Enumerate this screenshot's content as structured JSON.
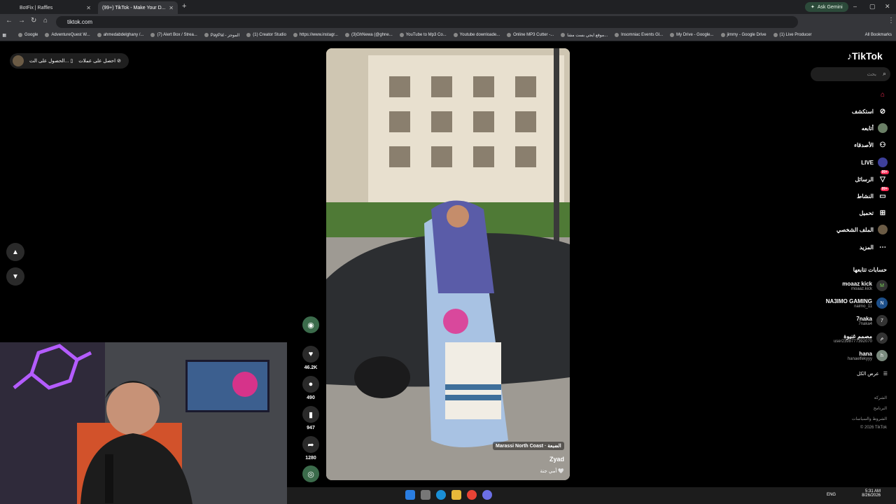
{
  "browser": {
    "tabs": [
      {
        "title": "BotFix | Raffles"
      },
      {
        "title": "(99+) TikTok - Make Your D..."
      }
    ],
    "new_tab": "+",
    "ask_gemini": "Ask Gemini",
    "url": "tiktok.com",
    "bookmarks": [
      "Google",
      "AdventureQuest W...",
      "ahmedabdelghany /...",
      "(7) Alert Box / Strea...",
      "PayPal - الموجز",
      "(1) Creator Studio",
      "https://www.instagr...",
      "(3)GhNewa (@ghne...",
      "YouTube to Mp3 Co...",
      "Youtube downloade...",
      "Online MP3 Cutter -...",
      "موقع ايجي بست مشا...",
      "Insomniac Events Gl...",
      "My Drive - Google...",
      "jimmy - Google Drive",
      "(1) Live Producer"
    ],
    "all_bookmarks": "All Bookmarks"
  },
  "tiktok": {
    "logo": "TikTok",
    "search_placeholder": "بحث",
    "get_coins": "احصل على عملات",
    "get_app": "الحصول على الت...",
    "nav": [
      {
        "label": "",
        "icon": "home-icon"
      },
      {
        "label": "استكشف",
        "icon": "compass-icon"
      },
      {
        "label": "أتابعه",
        "icon": "following-icon"
      },
      {
        "label": "الأصدقاء",
        "icon": "friends-icon"
      },
      {
        "label": "LIVE",
        "icon": "live-icon"
      },
      {
        "label": "الرسائل",
        "icon": "messages-icon",
        "badge": "99+"
      },
      {
        "label": "النشاط",
        "icon": "activity-icon",
        "badge": "99+"
      },
      {
        "label": "تحميل",
        "icon": "upload-icon"
      },
      {
        "label": "الملف الشخصي",
        "icon": "profile-icon"
      },
      {
        "label": "المزيد",
        "icon": "more-icon"
      }
    ],
    "following_title": "حسابات تتابعها",
    "following": [
      {
        "name": "moaaz kick",
        "handle": "moaaz.kick",
        "avatar": "M"
      },
      {
        "name": "NA3IMO GAMING",
        "handle": "naimo_11",
        "avatar": "N"
      },
      {
        "name": "7naka",
        "handle": "7naka4",
        "avatar": "7"
      },
      {
        "name": "مصمم غنيوة",
        "handle": "user2398777392070",
        "avatar": "م"
      },
      {
        "name": "hana",
        "handle": "hanaelfekyyy",
        "avatar": "h"
      }
    ],
    "see_all": "عرض الكل",
    "footer": [
      "الشركة",
      "البرنامج",
      "الشروط والسياسات",
      "© 2026 TikTok"
    ],
    "video": {
      "location": "Marassi North Coast · الضبعة",
      "author": "Zyad",
      "caption": "أمي جنة 🤍"
    },
    "actions": {
      "likes": "46.2K",
      "comments": "490",
      "saves": "947",
      "shares": "1280"
    }
  },
  "taskbar": {
    "lang": "ENG",
    "time": "5:31 AM",
    "date": "8/26/2026"
  }
}
